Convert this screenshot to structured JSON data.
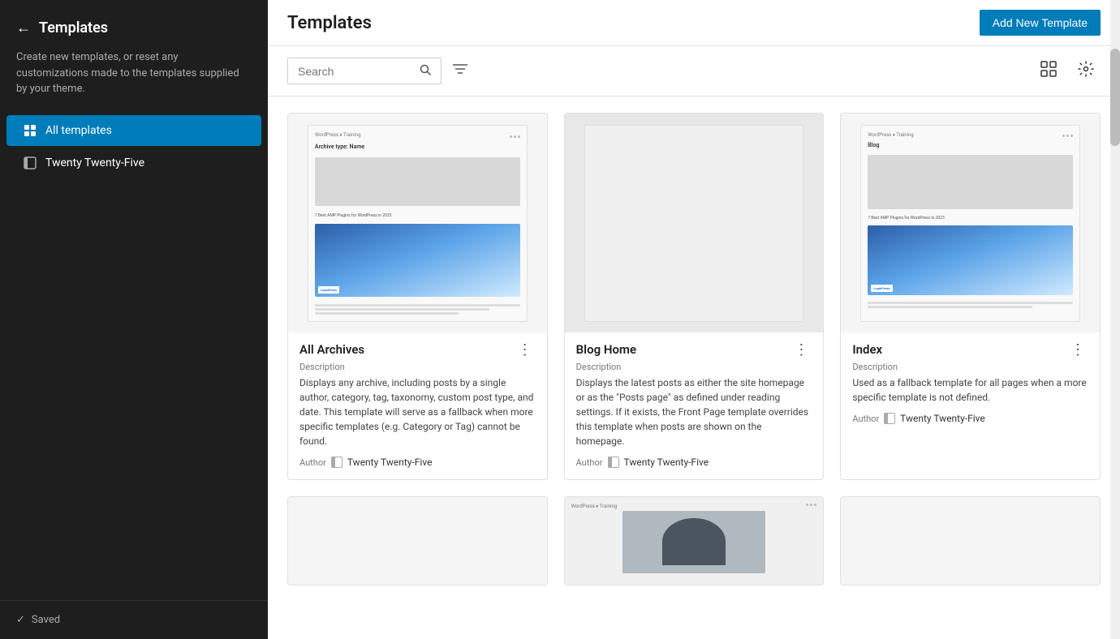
{
  "sidebar": {
    "back_label": "←",
    "title": "Templates",
    "description": "Create new templates, or reset any customizations made to the templates supplied by your theme.",
    "nav": [
      {
        "id": "all-templates",
        "label": "All templates",
        "active": true,
        "icon": "grid-icon"
      },
      {
        "id": "twenty-twenty-five",
        "label": "Twenty Twenty-Five",
        "active": false,
        "icon": "theme-icon"
      }
    ],
    "footer": {
      "check_icon": "✓",
      "saved_label": "Saved"
    }
  },
  "header": {
    "title": "Templates",
    "add_new_label": "Add New Template"
  },
  "toolbar": {
    "search_placeholder": "Search",
    "filter_icon": "≡",
    "grid_icon": "⊞",
    "settings_icon": "⚙"
  },
  "templates": [
    {
      "id": "all-archives",
      "name": "All Archives",
      "desc_label": "Description",
      "description": "Displays any archive, including posts by a single author, category, tag, taxonomy, custom post type, and date. This template will serve as a fallback when more specific templates (e.g. Category or Tag) cannot be found.",
      "author_label": "Author",
      "author_name": "Twenty Twenty-Five",
      "preview_type": "archive"
    },
    {
      "id": "blog-home",
      "name": "Blog Home",
      "desc_label": "Description",
      "description": "Displays the latest posts as either the site homepage or as the \"Posts page\" as defined under reading settings. If it exists, the Front Page template overrides this template when posts are shown on the homepage.",
      "author_label": "Author",
      "author_name": "Twenty Twenty-Five",
      "preview_type": "blog"
    },
    {
      "id": "index",
      "name": "Index",
      "desc_label": "Description",
      "description": "Used as a fallback template for all pages when a more specific template is not defined.",
      "author_label": "Author",
      "author_name": "Twenty Twenty-Five",
      "preview_type": "index"
    }
  ],
  "bottom_cards": [
    {
      "id": "bottom-1",
      "preview_type": "blank"
    },
    {
      "id": "bottom-2",
      "preview_type": "photo"
    },
    {
      "id": "bottom-3",
      "preview_type": "blank"
    }
  ],
  "colors": {
    "accent": "#007cba",
    "active_nav": "#007cba",
    "sidebar_bg": "#1e1e1e",
    "card_border": "#e0e0e0"
  }
}
